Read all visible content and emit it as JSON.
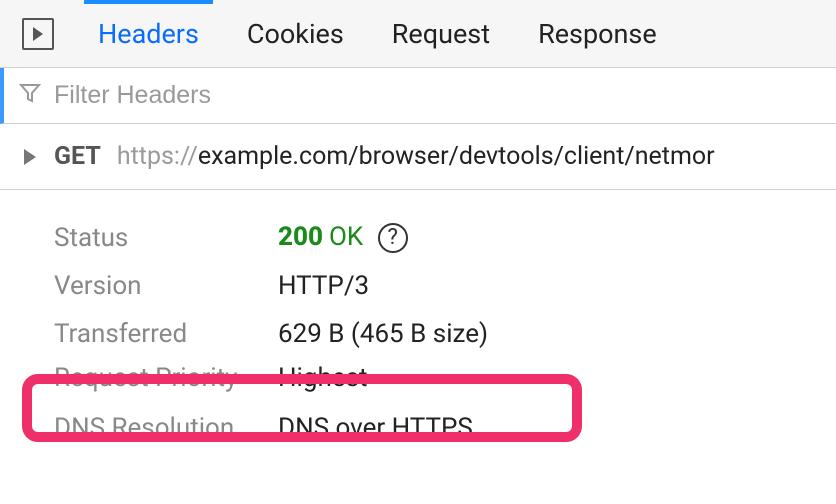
{
  "tabs": {
    "headers": "Headers",
    "cookies": "Cookies",
    "request": "Request",
    "response": "Response"
  },
  "filter": {
    "placeholder": "Filter Headers"
  },
  "request_line": {
    "method": "GET",
    "protocol": "https://",
    "rest": "example.com/browser/devtools/client/netmor"
  },
  "details": {
    "status_label": "Status",
    "status_code": "200",
    "status_text": "OK",
    "version_label": "Version",
    "version_value": "HTTP/3",
    "transferred_label": "Transferred",
    "transferred_value": "629 B (465 B size)",
    "priority_label": "Request Priority",
    "priority_value": "Highest",
    "dns_label": "DNS Resolution",
    "dns_value": "DNS over HTTPS"
  }
}
